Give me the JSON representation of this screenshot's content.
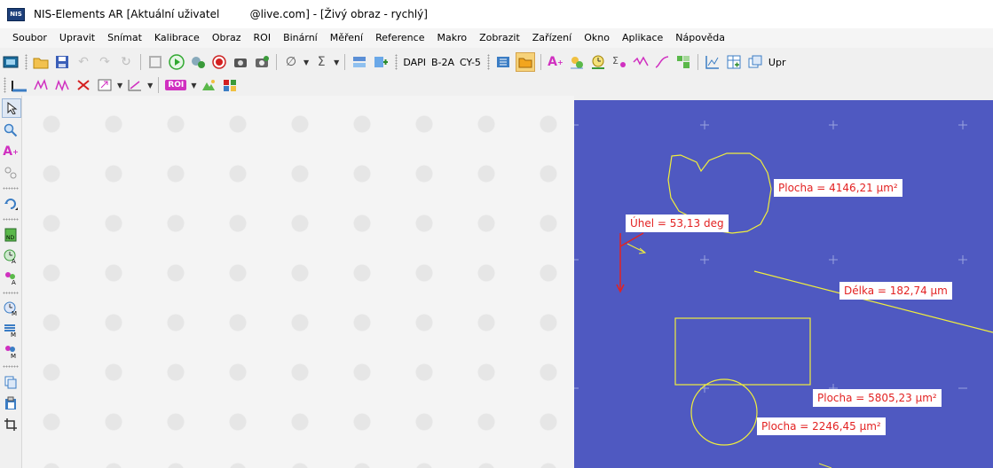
{
  "window": {
    "title": "NIS-Elements AR [Aktuální uživatel         @live.com] - [Živý obraz - rychlý]",
    "app_icon_text": "NIS"
  },
  "menu": [
    "Soubor",
    "Upravit",
    "Snímat",
    "Kalibrace",
    "Obraz",
    "ROI",
    "Binární",
    "Měření",
    "Reference",
    "Makro",
    "Zobrazit",
    "Zařízení",
    "Okno",
    "Aplikace",
    "Nápověda"
  ],
  "toolbar": {
    "channels": [
      "DAPI",
      "B-2A",
      "CY-5"
    ],
    "trailing_label": "Upr"
  },
  "toolbar2": {
    "roi_label": "ROI"
  },
  "measurements": {
    "area1": "Plocha = 4146,21 µm²",
    "angle": "Úhel = 53,13 deg",
    "length": "Délka = 182,74 µm",
    "area2": "Plocha = 5805,23 µm²",
    "area3": "Plocha = 2246,45 µm²"
  },
  "colors": {
    "image_background": "#4f59c1",
    "measure_line": "#f0ee3c",
    "angle_arrow": "#e32222",
    "label_text": "#e32222"
  }
}
